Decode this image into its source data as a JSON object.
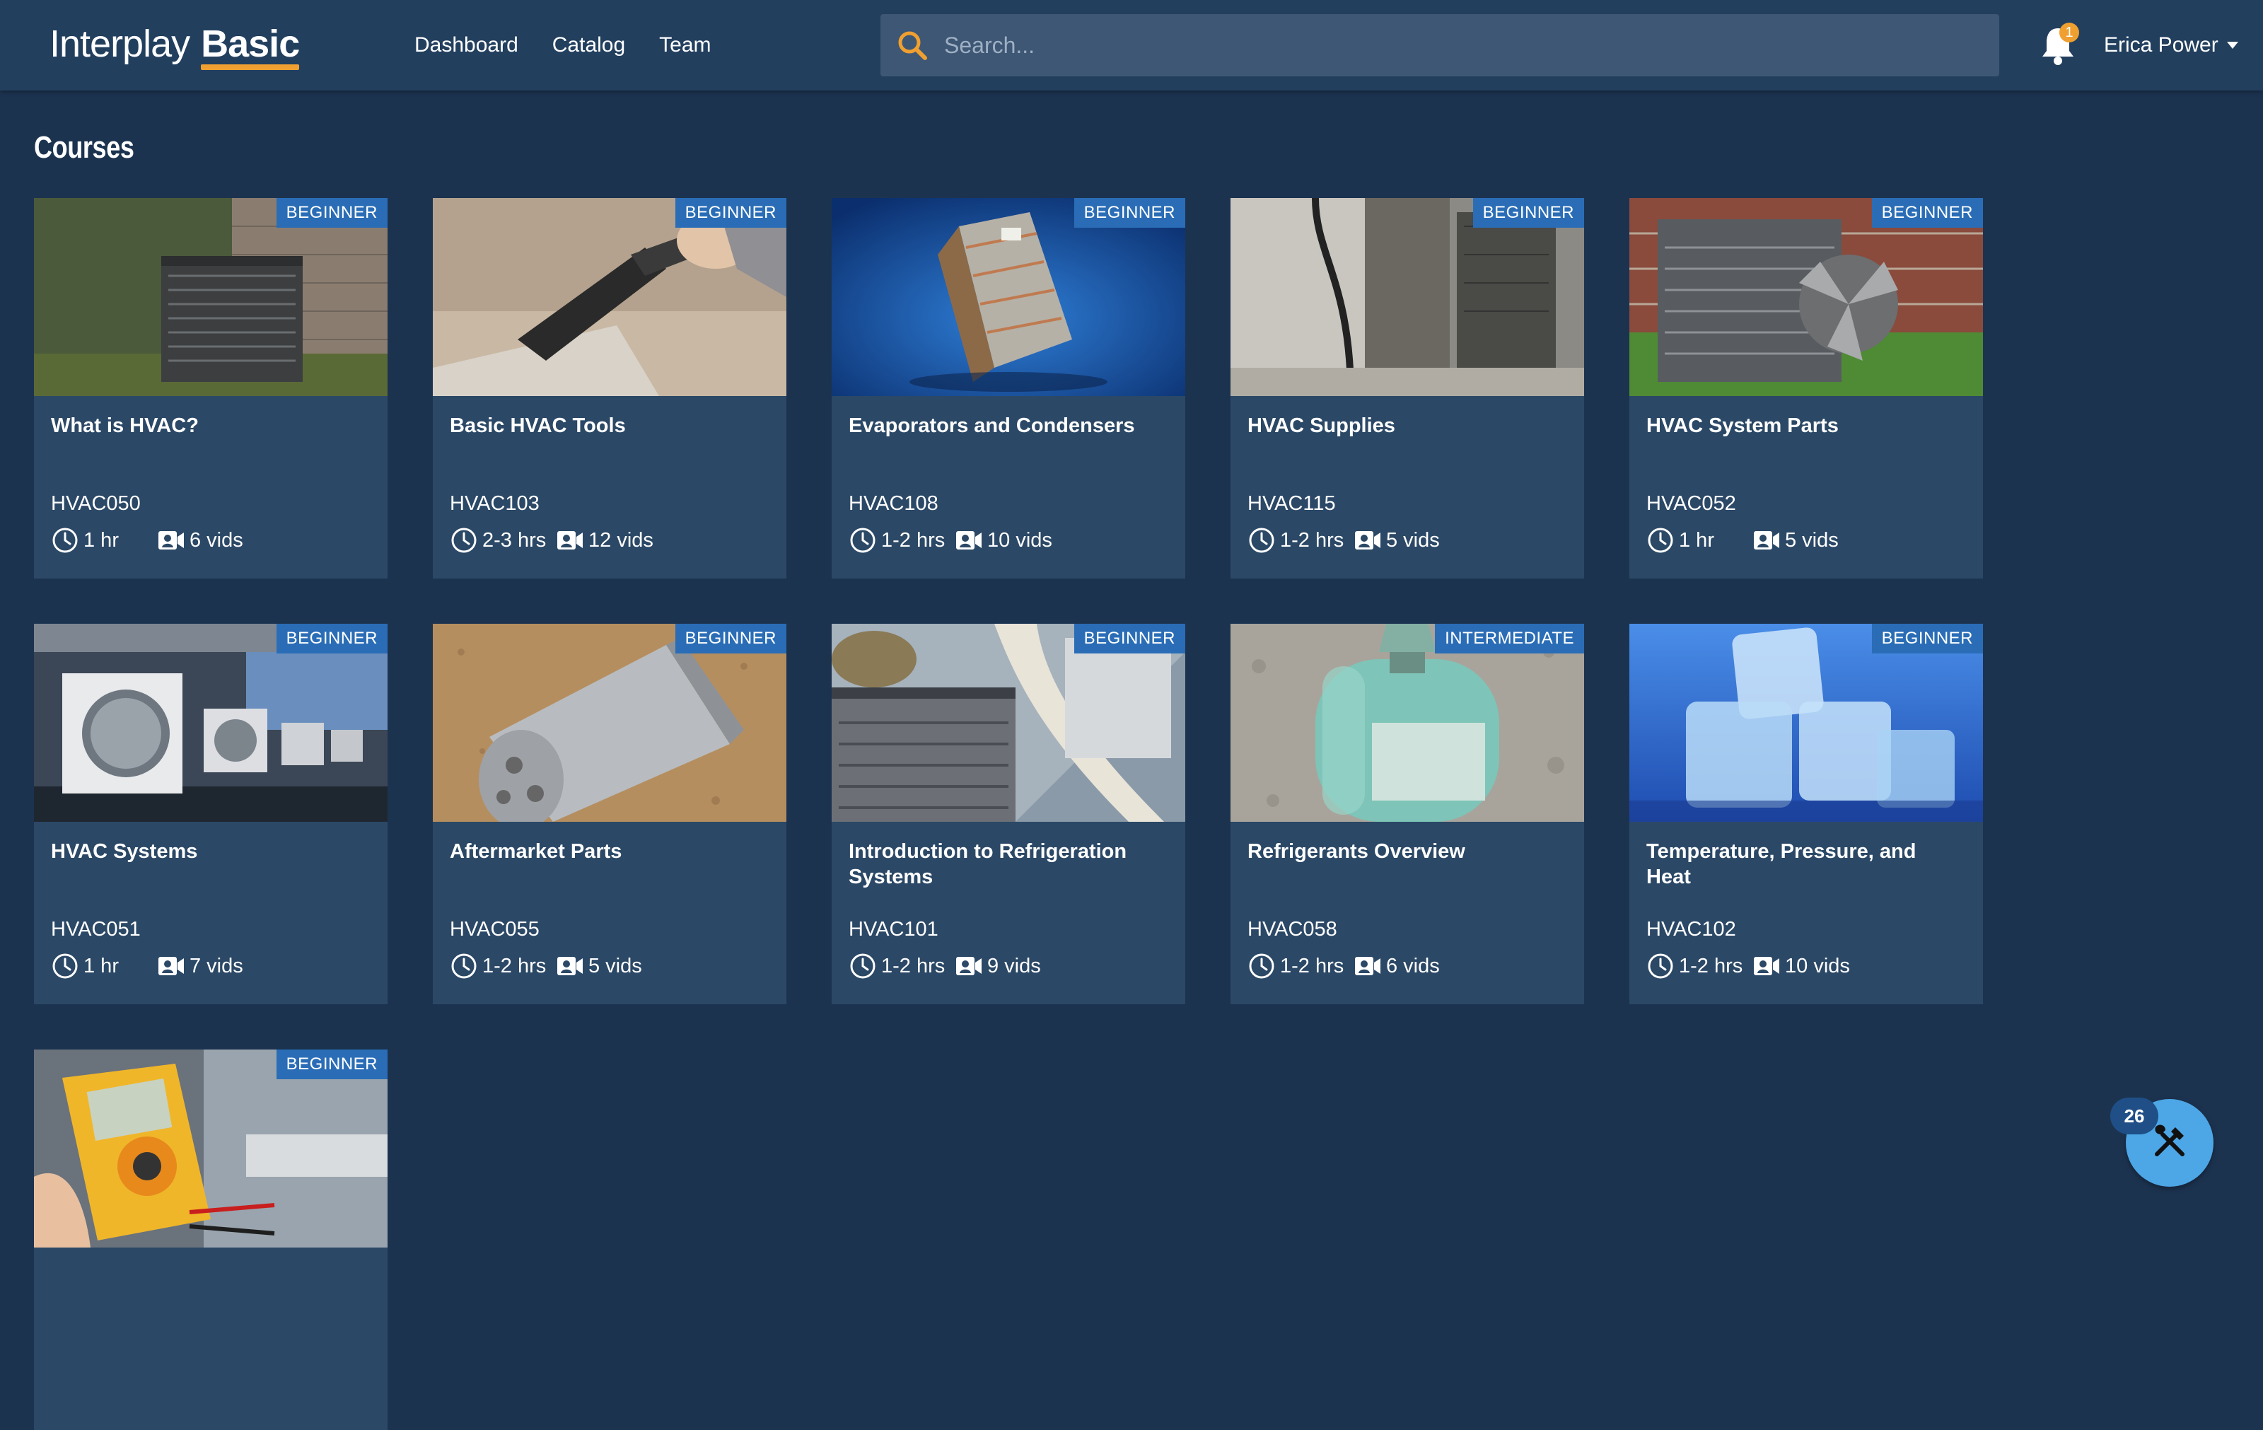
{
  "header": {
    "logo_brand": "Interplay",
    "logo_tier": "Basic",
    "nav": [
      "Dashboard",
      "Catalog",
      "Team"
    ],
    "search_placeholder": "Search...",
    "notification_count": "1",
    "user_name": "Erica Power"
  },
  "page": {
    "title": "Courses"
  },
  "courses": [
    {
      "level": "BEGINNER",
      "title": "What is HVAC?",
      "code": "HVAC050",
      "duration": "1 hr",
      "videos": "6 vids"
    },
    {
      "level": "BEGINNER",
      "title": "Basic HVAC Tools",
      "code": "HVAC103",
      "duration": "2-3 hrs",
      "videos": "12 vids"
    },
    {
      "level": "BEGINNER",
      "title": "Evaporators and Condensers",
      "code": "HVAC108",
      "duration": "1-2 hrs",
      "videos": "10 vids"
    },
    {
      "level": "BEGINNER",
      "title": "HVAC Supplies",
      "code": "HVAC115",
      "duration": "1-2 hrs",
      "videos": "5 vids"
    },
    {
      "level": "BEGINNER",
      "title": "HVAC System Parts",
      "code": "HVAC052",
      "duration": "1 hr",
      "videos": "5 vids"
    },
    {
      "level": "BEGINNER",
      "title": "HVAC Systems",
      "code": "HVAC051",
      "duration": "1 hr",
      "videos": "7 vids"
    },
    {
      "level": "BEGINNER",
      "title": "Aftermarket Parts",
      "code": "HVAC055",
      "duration": "1-2 hrs",
      "videos": "5 vids"
    },
    {
      "level": "BEGINNER",
      "title": "Introduction to Refrigeration Systems",
      "code": "HVAC101",
      "duration": "1-2 hrs",
      "videos": "9 vids"
    },
    {
      "level": "INTERMEDIATE",
      "title": "Refrigerants Overview",
      "code": "HVAC058",
      "duration": "1-2 hrs",
      "videos": "6 vids"
    },
    {
      "level": "BEGINNER",
      "title": "Temperature, Pressure, and Heat",
      "code": "HVAC102",
      "duration": "1-2 hrs",
      "videos": "10 vids"
    },
    {
      "level": "BEGINNER",
      "title": "",
      "code": "",
      "duration": "",
      "videos": ""
    }
  ],
  "tools_badge": "26",
  "icons": {
    "search": "search-icon",
    "bell": "bell-icon",
    "clock": "clock-icon",
    "video": "video-icon",
    "tools": "tools-icon"
  },
  "colors": {
    "background": "#1c3350",
    "header": "#223f5e",
    "card": "#2b4866",
    "level_badge": "#2a6db6",
    "accent": "#f0a030",
    "fab": "#4da6e6"
  }
}
